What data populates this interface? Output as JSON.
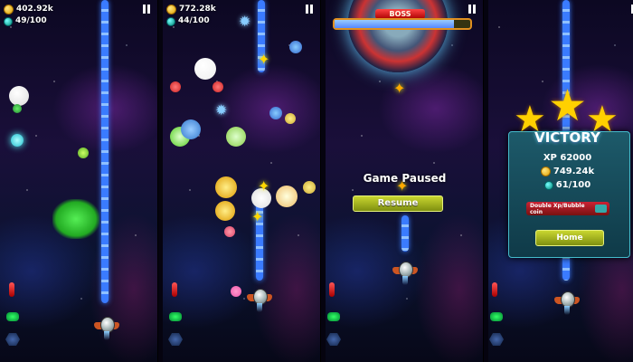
{
  "panels": [
    {
      "coins": "402.92k",
      "gems": "49/100"
    },
    {
      "coins": "772.28k",
      "gems": "44/100"
    },
    {
      "boss_label": "BOSS",
      "boss_health": 0.88,
      "paused_title": "Game Paused",
      "resume_label": "Resume"
    },
    {
      "victory_title": "VICTORY",
      "xp": "XP 62000",
      "coins": "749.24k",
      "gems": "61/100",
      "double_label": "Double Xp/Bubble coin",
      "home_label": "Home",
      "stars_earned": 3
    }
  ],
  "icons": [
    "coin-icon",
    "gem-icon",
    "pause-icon",
    "missile-icon",
    "shield-icon",
    "hex-icon",
    "star-icon"
  ],
  "colors": {
    "beam": "#3a7bff",
    "button": "#c9d630",
    "victory_panel": "#1d5a6a",
    "boss_label": "#e03030"
  }
}
